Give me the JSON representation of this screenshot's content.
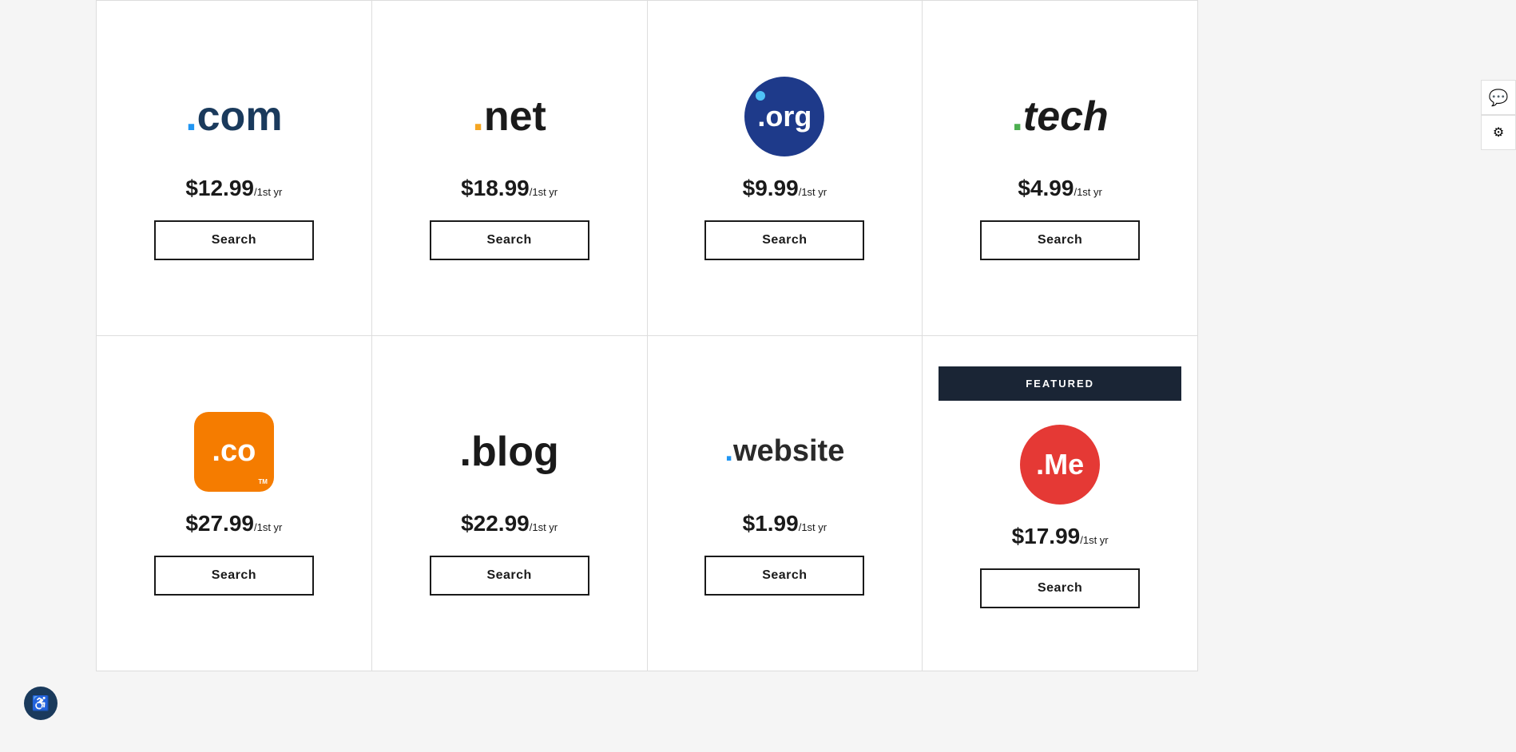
{
  "domains": {
    "row1": [
      {
        "id": "com",
        "logo_type": "com",
        "price": "$12.99",
        "period": "/1st yr",
        "search_label": "Search",
        "featured": false
      },
      {
        "id": "net",
        "logo_type": "net",
        "price": "$18.99",
        "period": "/1st yr",
        "search_label": "Search",
        "featured": false
      },
      {
        "id": "org",
        "logo_type": "org",
        "price": "$9.99",
        "period": "/1st yr",
        "search_label": "Search",
        "featured": false
      },
      {
        "id": "tech",
        "logo_type": "tech",
        "price": "$4.99",
        "period": "/1st yr",
        "search_label": "Search",
        "featured": false
      }
    ],
    "row2": [
      {
        "id": "co",
        "logo_type": "co",
        "price": "$27.99",
        "period": "/1st yr",
        "search_label": "Search",
        "featured": false
      },
      {
        "id": "blog",
        "logo_type": "blog",
        "price": "$22.99",
        "period": "/1st yr",
        "search_label": "Search",
        "featured": false
      },
      {
        "id": "website",
        "logo_type": "website",
        "price": "$1.99",
        "period": "/1st yr",
        "search_label": "Search",
        "featured": false
      },
      {
        "id": "me",
        "logo_type": "me",
        "price": "$17.99",
        "period": "/1st yr",
        "search_label": "Search",
        "featured": true,
        "featured_label": "FEATURED"
      }
    ]
  },
  "accessibility": {
    "label": "♿"
  },
  "side_widget": {
    "chat_icon": "💬",
    "settings_icon": "⚙"
  }
}
